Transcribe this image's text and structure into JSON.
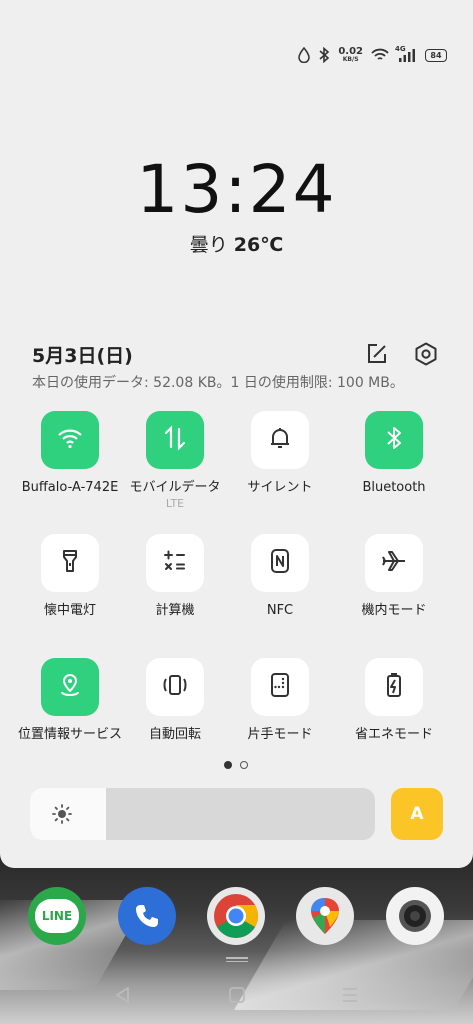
{
  "status": {
    "speed_value": "0.02",
    "speed_unit": "KB/S",
    "network": "4G",
    "battery": "84"
  },
  "clock": {
    "time": "13:24"
  },
  "weather": {
    "condition": "曇り",
    "temperature": "26℃"
  },
  "date": "5月3日(日)",
  "usage": "本日の使用データ: 52.08 KB。1 日の使用制限: 100 MB。",
  "tiles": [
    {
      "label": "Buffalo-A-742E",
      "icon": "wifi-icon",
      "on": true
    },
    {
      "label": "モバイルデータ",
      "sub": "LTE",
      "icon": "mobile-data-icon",
      "on": true
    },
    {
      "label": "サイレント",
      "icon": "bell-icon",
      "on": false
    },
    {
      "label": "Bluetooth",
      "icon": "bluetooth-icon",
      "on": true
    },
    {
      "label": "懐中電灯",
      "icon": "flashlight-icon",
      "on": false
    },
    {
      "label": "計算機",
      "icon": "calculator-icon",
      "on": false
    },
    {
      "label": "NFC",
      "icon": "nfc-icon",
      "on": false
    },
    {
      "label": "機内モード",
      "icon": "airplane-icon",
      "on": false
    },
    {
      "label": "位置情報サービス",
      "icon": "location-icon",
      "on": true
    },
    {
      "label": "自動回転",
      "icon": "auto-rotate-icon",
      "on": false
    },
    {
      "label": "片手モード",
      "icon": "one-hand-icon",
      "on": false
    },
    {
      "label": "省エネモード",
      "icon": "battery-saver-icon",
      "on": false
    }
  ],
  "pager": {
    "current": 1,
    "total": 2
  },
  "brightness": {
    "level": 0.22,
    "auto_label": "A"
  },
  "dock": [
    {
      "name": "LINE",
      "label": "LINE",
      "icon": "line-app-icon"
    },
    {
      "name": "Phone",
      "icon": "phone-app-icon"
    },
    {
      "name": "Chrome",
      "icon": "chrome-app-icon"
    },
    {
      "name": "Maps",
      "icon": "maps-app-icon"
    },
    {
      "name": "Camera",
      "icon": "camera-app-icon"
    }
  ],
  "colors": {
    "accent_green": "#2fd07e",
    "auto_yellow": "#fbc527",
    "panel_bg": "#efefef"
  }
}
